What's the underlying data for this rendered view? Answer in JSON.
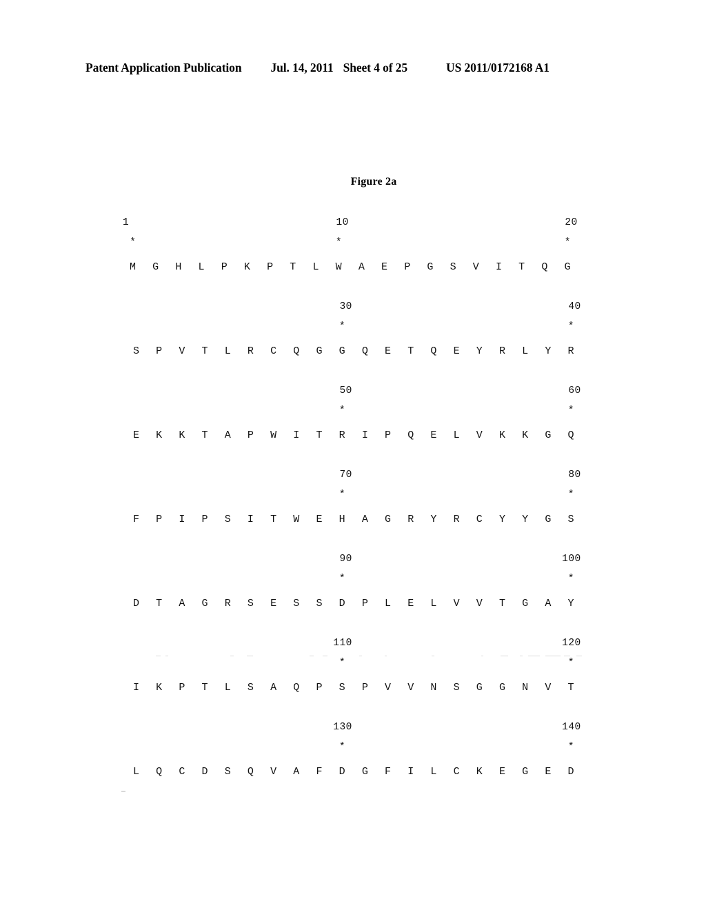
{
  "header": {
    "publication": "Patent Application Publication",
    "date": "Jul. 14, 2011",
    "sheet": "Sheet 4 of 25",
    "patent_number": "US 2011/0172168 A1"
  },
  "figure": {
    "title": "Figure 2a"
  },
  "sequence": {
    "residues_per_row": 20,
    "blocks": [
      {
        "start_label": "1",
        "markers": [
          {
            "index": 1,
            "label": "1"
          },
          {
            "index": 10,
            "label": "10"
          },
          {
            "index": 20,
            "label": "20"
          }
        ],
        "stars": [
          1,
          10,
          20
        ],
        "letters": [
          "M",
          "G",
          "H",
          "L",
          "P",
          "K",
          "P",
          "T",
          "L",
          "W",
          "A",
          "E",
          "P",
          "G",
          "S",
          "V",
          "I",
          "T",
          "Q",
          "G"
        ]
      },
      {
        "markers": [
          {
            "index": 10,
            "label": "30"
          },
          {
            "index": 20,
            "label": "40"
          }
        ],
        "stars": [
          10,
          20
        ],
        "letters": [
          "S",
          "P",
          "V",
          "T",
          "L",
          "R",
          "C",
          "Q",
          "G",
          "G",
          "Q",
          "E",
          "T",
          "Q",
          "E",
          "Y",
          "R",
          "L",
          "Y",
          "R"
        ]
      },
      {
        "markers": [
          {
            "index": 10,
            "label": "50"
          },
          {
            "index": 20,
            "label": "60"
          }
        ],
        "stars": [
          10,
          20
        ],
        "letters": [
          "E",
          "K",
          "K",
          "T",
          "A",
          "P",
          "W",
          "I",
          "T",
          "R",
          "I",
          "P",
          "Q",
          "E",
          "L",
          "V",
          "K",
          "K",
          "G",
          "Q"
        ]
      },
      {
        "markers": [
          {
            "index": 10,
            "label": "70"
          },
          {
            "index": 20,
            "label": "80"
          }
        ],
        "stars": [
          10,
          20
        ],
        "letters": [
          "F",
          "P",
          "I",
          "P",
          "S",
          "I",
          "T",
          "W",
          "E",
          "H",
          "A",
          "G",
          "R",
          "Y",
          "R",
          "C",
          "Y",
          "Y",
          "G",
          "S"
        ]
      },
      {
        "markers": [
          {
            "index": 10,
            "label": "90"
          },
          {
            "index": 20,
            "label": "100"
          }
        ],
        "stars": [
          10,
          20
        ],
        "letters": [
          "D",
          "T",
          "A",
          "G",
          "R",
          "S",
          "E",
          "S",
          "S",
          "D",
          "P",
          "L",
          "E",
          "L",
          "V",
          "V",
          "T",
          "G",
          "A",
          "Y"
        ]
      },
      {
        "markers": [
          {
            "index": 10,
            "label": "110"
          },
          {
            "index": 20,
            "label": "120"
          }
        ],
        "stars": [
          10,
          20
        ],
        "letters": [
          "I",
          "K",
          "P",
          "T",
          "L",
          "S",
          "A",
          "Q",
          "P",
          "S",
          "P",
          "V",
          "V",
          "N",
          "S",
          "G",
          "G",
          "N",
          "V",
          "T"
        ]
      },
      {
        "markers": [
          {
            "index": 10,
            "label": "130"
          },
          {
            "index": 20,
            "label": "140"
          }
        ],
        "stars": [
          10,
          20
        ],
        "letters": [
          "L",
          "Q",
          "C",
          "D",
          "S",
          "Q",
          "V",
          "A",
          "F",
          "D",
          "G",
          "F",
          "I",
          "L",
          "C",
          "K",
          "E",
          "G",
          "E",
          "D"
        ]
      }
    ],
    "star_glyph": "*"
  }
}
